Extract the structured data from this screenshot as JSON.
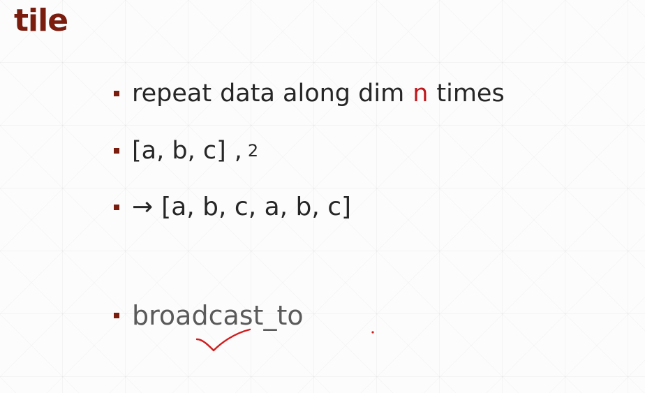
{
  "slide": {
    "title": "tile",
    "bullets": {
      "repeat": {
        "before": "repeat",
        "middle": "data along dim",
        "highlight": "n",
        "after": "times"
      },
      "input": {
        "list": "[a, b, c]",
        "sep": ",",
        "count": "2"
      },
      "output": {
        "arrow": "→",
        "list": "[a, b, c, a, b, c]"
      },
      "broadcast": {
        "label": "broadcast_to"
      }
    }
  },
  "colors": {
    "title": "#7a1d0f",
    "bullet_marker": "#7a1d0f",
    "highlight": "#c0161b",
    "annotation": "#d21c1c"
  },
  "annotation": {
    "icon": "checkmark-icon"
  }
}
